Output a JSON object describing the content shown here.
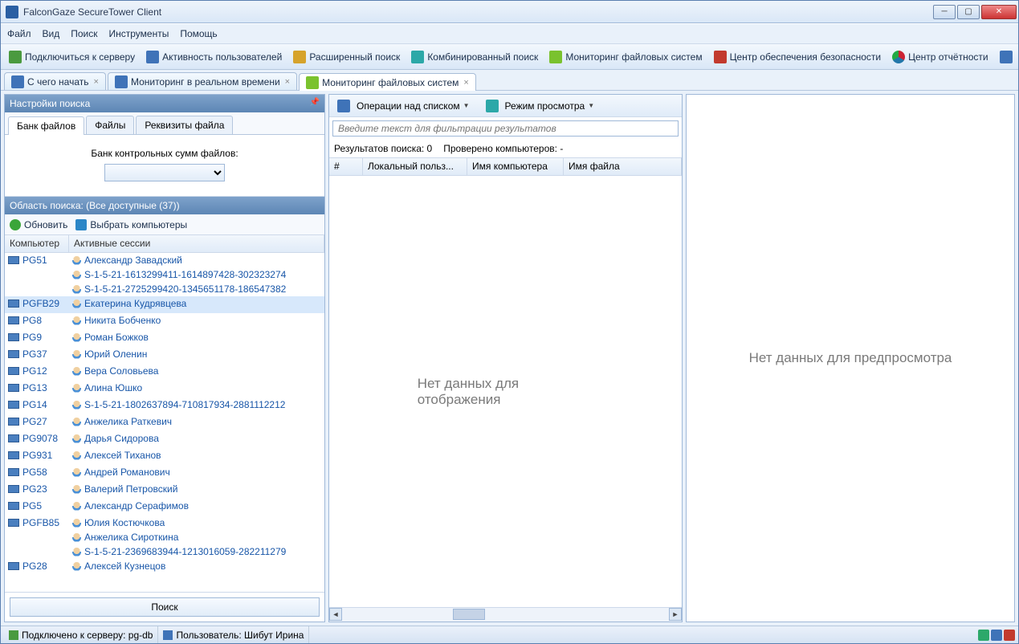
{
  "window": {
    "title": "FalconGaze SecureTower Client"
  },
  "menu": {
    "file": "Файл",
    "view": "Вид",
    "search": "Поиск",
    "tools": "Инструменты",
    "help": "Помощь"
  },
  "toolbar": {
    "connect": "Подключиться к серверу",
    "activity": "Активность пользователей",
    "advsearch": "Расширенный поиск",
    "combsearch": "Комбинированный поиск",
    "fsmon": "Мониторинг файловых систем",
    "seccenter": "Центр обеспечения безопасности",
    "reports": "Центр отчётности"
  },
  "tabs": {
    "start": "С чего начать",
    "realtime": "Мониторинг в реальном времени",
    "fsmon": "Мониторинг файловых систем"
  },
  "left": {
    "settings_title": "Настройки поиска",
    "subtabs": {
      "bank": "Банк файлов",
      "files": "Файлы",
      "props": "Реквизиты файла"
    },
    "bank_label": "Банк контрольных сумм файлов:",
    "scope_title": "Область поиска: (Все доступные (37))",
    "refresh": "Обновить",
    "select_comp": "Выбрать компьютеры",
    "col_computer": "Компьютер",
    "col_sessions": "Активные сессии",
    "search_btn": "Поиск",
    "rows": [
      {
        "computer": "PG51",
        "sessions": [
          "Александр Завадский",
          "S-1-5-21-1613299411-1614897428-302323274",
          "S-1-5-21-2725299420-1345651178-186547382"
        ]
      },
      {
        "computer": "PGFB29",
        "sessions": [
          "Екатерина Кудрявцева"
        ],
        "selected": true
      },
      {
        "computer": "PG8",
        "sessions": [
          "Никита Бобченко"
        ]
      },
      {
        "computer": "PG9",
        "sessions": [
          "Роман Божков"
        ]
      },
      {
        "computer": "PG37",
        "sessions": [
          "Юрий Оленин"
        ]
      },
      {
        "computer": "PG12",
        "sessions": [
          "Вера Соловьева"
        ]
      },
      {
        "computer": "PG13",
        "sessions": [
          "Алина Юшко"
        ]
      },
      {
        "computer": "PG14",
        "sessions": [
          "S-1-5-21-1802637894-710817934-2881112212"
        ]
      },
      {
        "computer": "PG27",
        "sessions": [
          "Анжелика Раткевич"
        ]
      },
      {
        "computer": "PG9078",
        "sessions": [
          "Дарья Сидорова"
        ]
      },
      {
        "computer": "PG931",
        "sessions": [
          "Алексей Тиханов"
        ]
      },
      {
        "computer": "PG58",
        "sessions": [
          "Андрей Романович"
        ]
      },
      {
        "computer": "PG23",
        "sessions": [
          "Валерий Петровский"
        ]
      },
      {
        "computer": "PG5",
        "sessions": [
          "Александр Серафимов"
        ]
      },
      {
        "computer": "PGFB85",
        "sessions": [
          "Юлия Костючкова",
          "Анжелика Сироткина",
          "S-1-5-21-2369683944-1213016059-282211279"
        ]
      },
      {
        "computer": "PG28",
        "sessions": [
          "Алексей Кузнецов"
        ]
      }
    ]
  },
  "mid": {
    "listops": "Операции над списком",
    "viewmode": "Режим просмотра",
    "filter_placeholder": "Введите текст для фильтрации результатов",
    "results_label": "Результатов поиска: 0",
    "checked_label": "Проверено компьютеров:   -",
    "col_num": "#",
    "col_user": "Локальный польз...",
    "col_comp": "Имя компьютера",
    "col_file": "Имя файла",
    "nodata": "Нет данных для отображения"
  },
  "right": {
    "nodata": "Нет данных для предпросмотра"
  },
  "status": {
    "connected": "Подключено к серверу: pg-db",
    "user": "Пользователь: Шибут Ирина"
  }
}
